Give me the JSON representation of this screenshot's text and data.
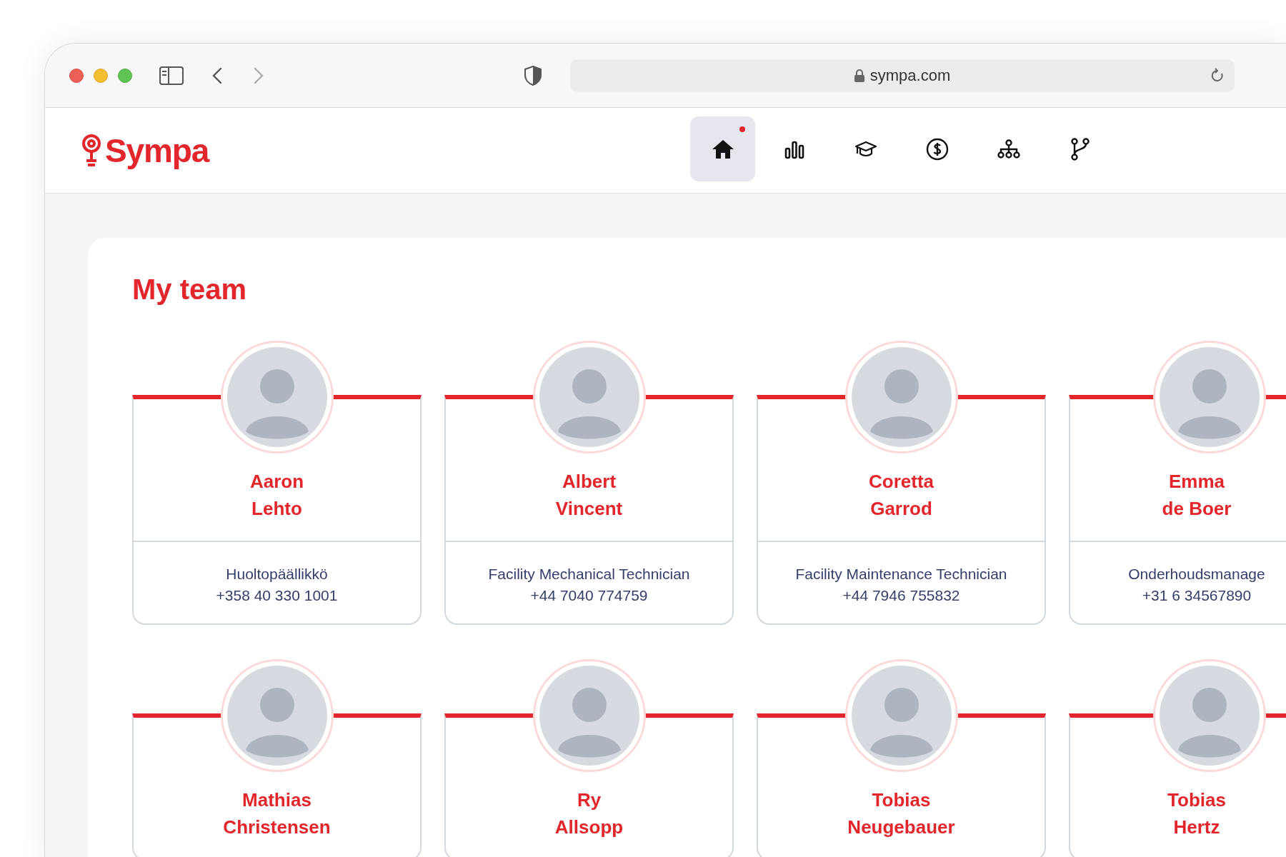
{
  "browser": {
    "url": "sympa.com"
  },
  "app": {
    "logo": "Sympa",
    "nav": [
      {
        "kind": "home",
        "selected": true,
        "badge": true
      },
      {
        "kind": "chart",
        "selected": false,
        "badge": false
      },
      {
        "kind": "cap",
        "selected": false,
        "badge": false
      },
      {
        "kind": "dollar",
        "selected": false,
        "badge": false
      },
      {
        "kind": "org",
        "selected": false,
        "badge": false
      },
      {
        "kind": "branch",
        "selected": false,
        "badge": false
      }
    ]
  },
  "team": {
    "title": "My team",
    "members": [
      {
        "first": "Aaron",
        "last": "Lehto",
        "role": "Huoltopäällikkö",
        "phone": "+358 40 330 1001"
      },
      {
        "first": "Albert",
        "last": "Vincent",
        "role": "Facility Mechanical Technician",
        "phone": "+44 7040 774759"
      },
      {
        "first": "Coretta",
        "last": "Garrod",
        "role": "Facility Maintenance Technician",
        "phone": "+44 7946 755832"
      },
      {
        "first": "Emma",
        "last": "de Boer",
        "role": "Onderhoudsmanage",
        "phone": "+31 6 34567890"
      },
      {
        "first": "Mathias",
        "last": "Christensen"
      },
      {
        "first": "Ry",
        "last": "Allsopp"
      },
      {
        "first": "Tobias",
        "last": "Neugebauer"
      },
      {
        "first": "Tobias",
        "last": "Hertz"
      }
    ]
  }
}
